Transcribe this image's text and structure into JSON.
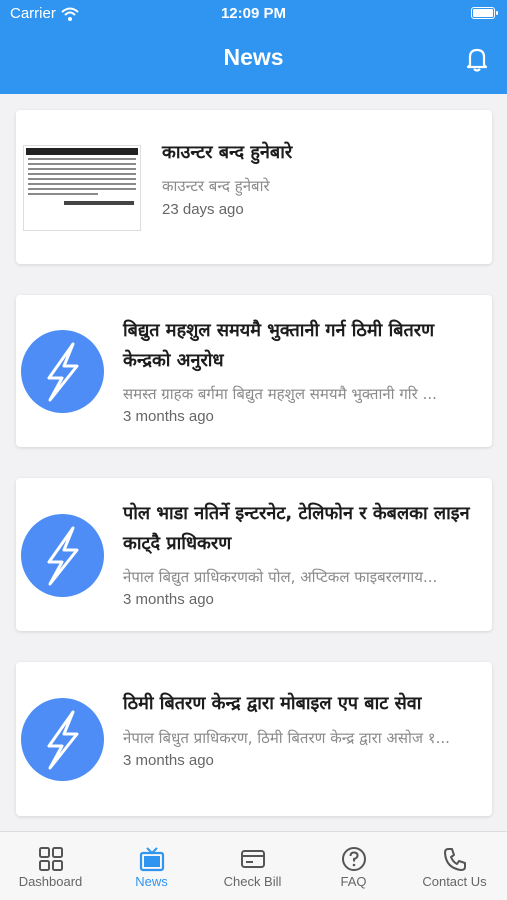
{
  "status_bar": {
    "carrier": "Carrier",
    "time": "12:09 PM"
  },
  "header": {
    "title": "News",
    "bell_icon": "bell-icon"
  },
  "colors": {
    "brand": "#2f95f1",
    "avatar": "#4e8df5"
  },
  "news": [
    {
      "title": "काउन्टर बन्द हुनेबारे",
      "summary": "काउन्टर बन्द हुनेबारे",
      "date": "23 days ago",
      "image": "newspaper-clipping"
    },
    {
      "title": "बिद्युत महशुल समयमै भुक्तानी गर्न ठिमी बितरण केन्द्रको अनुरोध",
      "summary": "समस्त ग्राहक बर्गमा बिद्युत महशुल समयमै भुक्तानी गरि ...",
      "date": "3 months ago",
      "image": "lightning-icon"
    },
    {
      "title": "पोल भाडा नतिर्ने इन्टरनेट, टेलिफोन र केबलका लाइन काट्दै प्राधिकरण",
      "summary": "नेपाल बिद्युत प्राधिकरणको पोल, अप्टिकल फाइबरलगाय...",
      "date": "3 months ago",
      "image": "lightning-icon"
    },
    {
      "title": "ठिमी बितरण केन्द्र द्वारा मोबाइल एप बाट सेवा",
      "summary": "नेपाल बिधुत प्राधिकरण, ठिमी बितरण केन्द्र द्वारा असोज १...",
      "date": "3 months ago",
      "image": "lightning-icon"
    }
  ],
  "tabs": [
    {
      "label": "Dashboard",
      "icon": "grid-icon",
      "active": false
    },
    {
      "label": "News",
      "icon": "tv-icon",
      "active": true
    },
    {
      "label": "Check Bill",
      "icon": "card-icon",
      "active": false
    },
    {
      "label": "FAQ",
      "icon": "question-icon",
      "active": false
    },
    {
      "label": "Contact Us",
      "icon": "phone-icon",
      "active": false
    }
  ]
}
